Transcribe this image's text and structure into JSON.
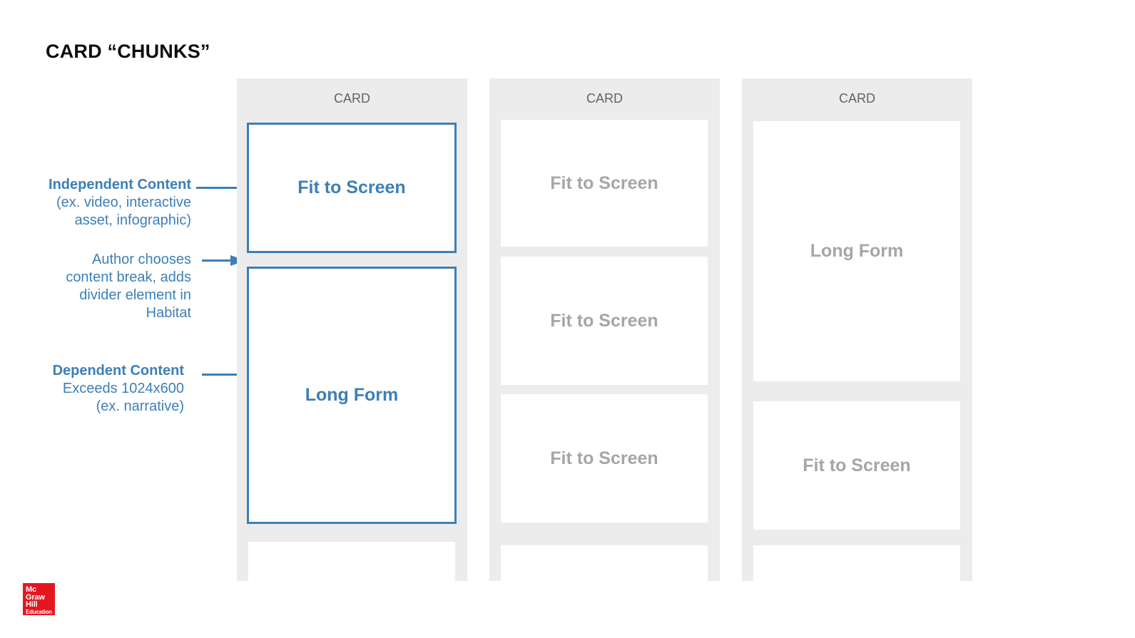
{
  "title": "CARD “CHUNKS”",
  "colors": {
    "accent_blue": "#3c7fb8",
    "card_background": "#ececec",
    "chunk_background": "#ffffff",
    "chunk_text_gray": "#a6a6a6",
    "card_label_gray": "#636363",
    "logo_red": "#e4171f",
    "title_black": "#0d0d0d"
  },
  "annotations": {
    "independent": {
      "strong": "Independent Content",
      "line1": "(ex. video, interactive",
      "line2": "asset, infographic)"
    },
    "author": {
      "line1": "Author chooses",
      "line2": "content break, adds",
      "line3": "divider element in",
      "line4": "Habitat"
    },
    "dependent": {
      "strong": "Dependent Content",
      "line1": "Exceeds 1024x600",
      "line2": "(ex. narrative)"
    }
  },
  "cards": [
    {
      "label": "CARD",
      "chunks": [
        {
          "text": "Fit to Screen",
          "highlight": true
        },
        {
          "text": "Long Form",
          "highlight": true
        },
        {
          "text": "",
          "highlight": false
        }
      ]
    },
    {
      "label": "CARD",
      "chunks": [
        {
          "text": "Fit to Screen",
          "highlight": false
        },
        {
          "text": "Fit to Screen",
          "highlight": false
        },
        {
          "text": "Fit to Screen",
          "highlight": false
        },
        {
          "text": "",
          "highlight": false
        }
      ]
    },
    {
      "label": "CARD",
      "chunks": [
        {
          "text": "Long Form",
          "highlight": false
        },
        {
          "text": "Fit to Screen",
          "highlight": false
        },
        {
          "text": "",
          "highlight": false
        }
      ]
    }
  ],
  "logo": {
    "line1": "Mc",
    "line2": "Graw",
    "line3": "Hill",
    "line4": "Education"
  }
}
